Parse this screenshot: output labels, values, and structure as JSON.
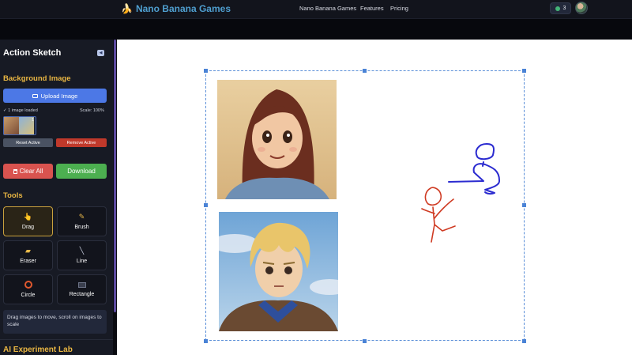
{
  "header": {
    "brand_icon": "banana-icon",
    "brand_name": "Nano Banana Games",
    "nav": [
      "Nano Banana Games",
      "Features",
      "Pricing"
    ],
    "counter_value": "3"
  },
  "sidebar": {
    "title": "Action Sketch",
    "collapse_icon": "collapse-icon",
    "background_image": {
      "heading": "Background Image",
      "upload_label": "Upload Image",
      "status_text": "✓ 1 image loaded",
      "scale_text": "Scale: 100%",
      "thumb_count": "1",
      "reset_label": "Reset Active",
      "remove_label": "Remove Active"
    },
    "clear_label": "Clear All",
    "download_label": "Download",
    "tools_heading": "Tools",
    "tools": [
      {
        "label": "Drag",
        "icon": "hand-pointer-icon",
        "active": true
      },
      {
        "label": "Brush",
        "icon": "brush-icon",
        "active": false
      },
      {
        "label": "Eraser",
        "icon": "eraser-icon",
        "active": false
      },
      {
        "label": "Line",
        "icon": "line-icon",
        "active": false
      },
      {
        "label": "Circle",
        "icon": "circle-icon",
        "active": false
      },
      {
        "label": "Rectangle",
        "icon": "rectangle-icon",
        "active": false
      }
    ],
    "hint": "Drag images to move, scroll on images to scale",
    "next_section": "AI Experiment Lab"
  },
  "colors": {
    "accent": "#e9b643",
    "upload_blue": "#4c78e6",
    "clear_red": "#d9534f",
    "download_green": "#4caf50",
    "reset_gray": "#4a5262",
    "remove_red": "#c0392b",
    "stroke_blue": "#2b2bd0",
    "stroke_red": "#cf3a22",
    "selection": "#5b8fd8"
  }
}
